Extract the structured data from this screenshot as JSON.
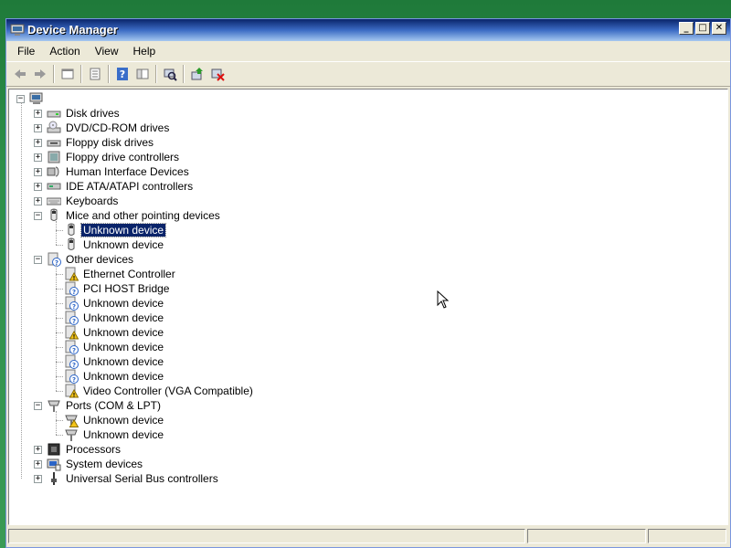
{
  "window": {
    "title": "Device Manager"
  },
  "menu": [
    {
      "label": "File"
    },
    {
      "label": "Action"
    },
    {
      "label": "View"
    },
    {
      "label": "Help"
    }
  ],
  "toolbar": {
    "buttons": [
      "back-icon",
      "forward-icon",
      "up-level-icon",
      "properties-icon",
      "help-icon",
      "console-tree-icon",
      "scan-hardware-icon",
      "update-driver-icon",
      "uninstall-icon"
    ]
  },
  "tree": {
    "root": {
      "label": ""
    },
    "items": [
      {
        "label": "Disk drives",
        "expanded": false,
        "icon": "disk-drive-icon",
        "children": []
      },
      {
        "label": "DVD/CD-ROM drives",
        "expanded": false,
        "icon": "cdrom-icon",
        "children": []
      },
      {
        "label": "Floppy disk drives",
        "expanded": false,
        "icon": "floppy-drive-icon",
        "children": []
      },
      {
        "label": "Floppy drive controllers",
        "expanded": false,
        "icon": "floppy-controller-icon",
        "children": []
      },
      {
        "label": "Human Interface Devices",
        "expanded": false,
        "icon": "hid-icon",
        "children": []
      },
      {
        "label": "IDE ATA/ATAPI controllers",
        "expanded": false,
        "icon": "ide-controller-icon",
        "children": []
      },
      {
        "label": "Keyboards",
        "expanded": false,
        "icon": "keyboard-icon",
        "children": []
      },
      {
        "label": "Mice and other pointing devices",
        "expanded": true,
        "icon": "mouse-icon",
        "children": [
          {
            "label": "Unknown device",
            "icon": "mouse-icon",
            "selected": true
          },
          {
            "label": "Unknown device",
            "icon": "mouse-icon"
          }
        ]
      },
      {
        "label": "Other devices",
        "expanded": true,
        "icon": "unknown-device-icon",
        "children": [
          {
            "label": "Ethernet Controller",
            "icon": "warning-device-icon"
          },
          {
            "label": "PCI HOST Bridge",
            "icon": "unknown-device-icon"
          },
          {
            "label": "Unknown device",
            "icon": "unknown-device-icon"
          },
          {
            "label": "Unknown device",
            "icon": "unknown-device-icon"
          },
          {
            "label": "Unknown device",
            "icon": "warning-device-icon"
          },
          {
            "label": "Unknown device",
            "icon": "unknown-device-icon"
          },
          {
            "label": "Unknown device",
            "icon": "unknown-device-icon"
          },
          {
            "label": "Unknown device",
            "icon": "unknown-device-icon"
          },
          {
            "label": "Video Controller (VGA Compatible)",
            "icon": "warning-device-icon"
          }
        ]
      },
      {
        "label": "Ports (COM & LPT)",
        "expanded": true,
        "icon": "port-icon",
        "children": [
          {
            "label": "Unknown device",
            "icon": "warning-port-icon"
          },
          {
            "label": "Unknown device",
            "icon": "port-icon"
          }
        ]
      },
      {
        "label": "Processors",
        "expanded": false,
        "icon": "processor-icon",
        "children": []
      },
      {
        "label": "System devices",
        "expanded": false,
        "icon": "system-device-icon",
        "children": []
      },
      {
        "label": "Universal Serial Bus controllers",
        "expanded": false,
        "icon": "usb-icon",
        "children": []
      }
    ]
  },
  "colors": {
    "selection": "#0a246a",
    "title_bar": "#0a246a",
    "chrome": "#ece9d8"
  }
}
